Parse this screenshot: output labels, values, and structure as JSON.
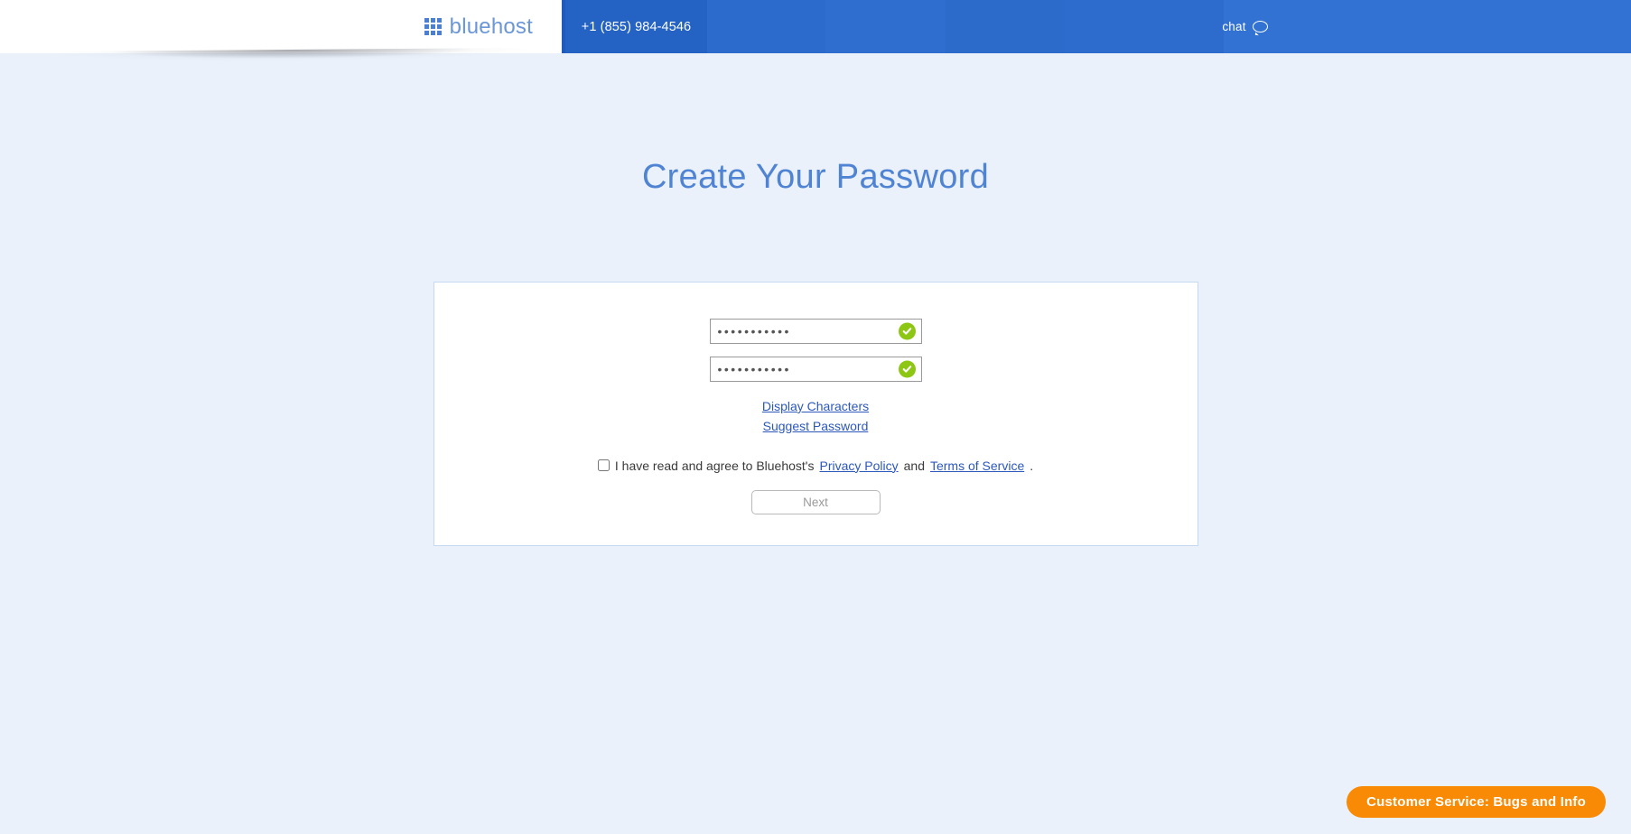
{
  "header": {
    "logo_text": "bluehost",
    "logo_icon": "grid-3x3-icon",
    "phone": "+1 (855) 984-4546",
    "chat_label": "chat",
    "chat_icon": "speech-bubble-icon",
    "white_bg": "#ffffff",
    "blue_accent": "#2463c4"
  },
  "page": {
    "title": "Create Your Password",
    "background": "#eaf1fa",
    "title_color": "#4f83d4"
  },
  "form": {
    "password": {
      "value": "•••••••••••",
      "placeholder": "",
      "valid_icon": "check-circle-icon",
      "valid_color": "#8dc713"
    },
    "confirm_password": {
      "value": "•••••••••••",
      "placeholder": "",
      "valid_icon": "check-circle-icon",
      "valid_color": "#8dc713"
    },
    "links": [
      {
        "label": "Display Characters"
      },
      {
        "label": "Suggest Password"
      }
    ],
    "agreement": {
      "checked": false,
      "prefix": "I have read and agree to Bluehost's ",
      "privacy_label": "Privacy Policy",
      "conjunction": " and ",
      "terms_label": "Terms of Service",
      "suffix": "."
    },
    "next_label": "Next"
  },
  "footer": {
    "badge_label": "Customer Service: Bugs and Info",
    "badge_color": "#f88a06"
  }
}
